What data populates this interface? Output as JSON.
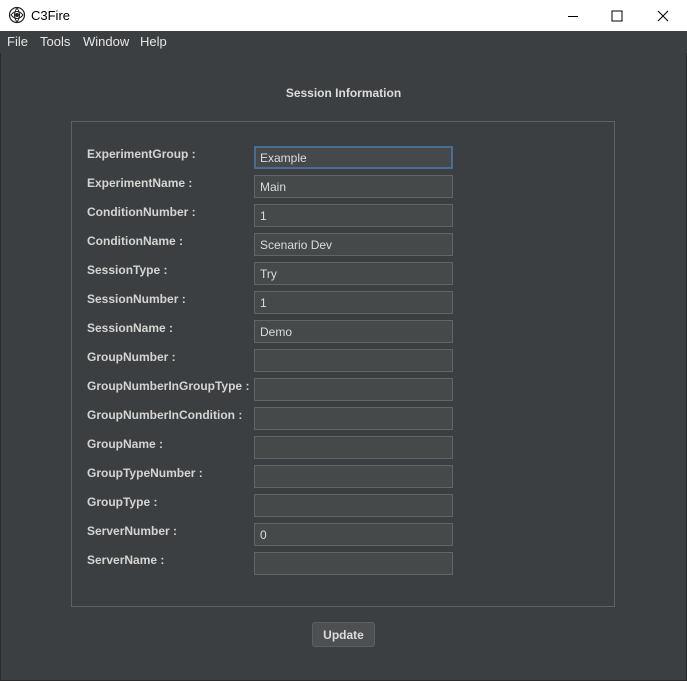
{
  "window": {
    "title": "C3Fire",
    "minimize_icon": "minimize-icon",
    "maximize_icon": "maximize-icon",
    "close_icon": "close-icon"
  },
  "menu": [
    "File",
    "Tools",
    "Window",
    "Help"
  ],
  "section_title": "Session Information",
  "fields": [
    {
      "label": "ExperimentGroup :",
      "value": "Example"
    },
    {
      "label": "ExperimentName :",
      "value": "Main"
    },
    {
      "label": "ConditionNumber :",
      "value": "1"
    },
    {
      "label": "ConditionName :",
      "value": "Scenario Dev"
    },
    {
      "label": "SessionType :",
      "value": "Try"
    },
    {
      "label": "SessionNumber :",
      "value": "1"
    },
    {
      "label": "SessionName :",
      "value": "Demo"
    },
    {
      "label": "GroupNumber :",
      "value": ""
    },
    {
      "label": "GroupNumberInGroupType :",
      "value": ""
    },
    {
      "label": "GroupNumberInCondition :",
      "value": ""
    },
    {
      "label": "GroupName :",
      "value": ""
    },
    {
      "label": "GroupTypeNumber :",
      "value": ""
    },
    {
      "label": "GroupType :",
      "value": ""
    },
    {
      "label": "ServerNumber :",
      "value": "0"
    },
    {
      "label": "ServerName :",
      "value": ""
    }
  ],
  "update_button": "Update",
  "colors": {
    "background": "#3c3f41",
    "input_background": "#45494a",
    "focus_border": "#4a6d93",
    "text": "#dcdcdc"
  }
}
